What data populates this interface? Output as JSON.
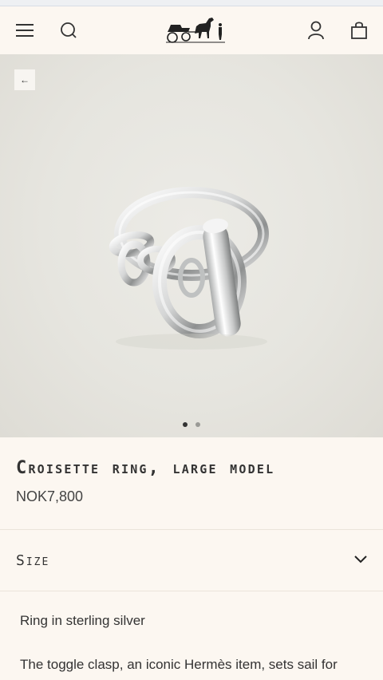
{
  "header": {
    "menu_icon": "hamburger-menu-icon",
    "search_icon": "search-icon",
    "logo": "hermes-carriage-logo",
    "account_icon": "user-icon",
    "bag_icon": "shopping-bag-icon"
  },
  "gallery": {
    "back_icon": "←",
    "slide_count": 2,
    "active_slide": 1
  },
  "product": {
    "title": "Croisette ring, large model",
    "price": "NOK7,800"
  },
  "size": {
    "label": "Size",
    "icon": "chevron-down-icon"
  },
  "description": {
    "line1": "Ring in sterling silver",
    "line2": "The toggle clasp, an iconic Hermès item, sets sail for"
  },
  "colors": {
    "background": "#fcf7f1",
    "text": "#333333",
    "hero": "#e6e5df"
  }
}
